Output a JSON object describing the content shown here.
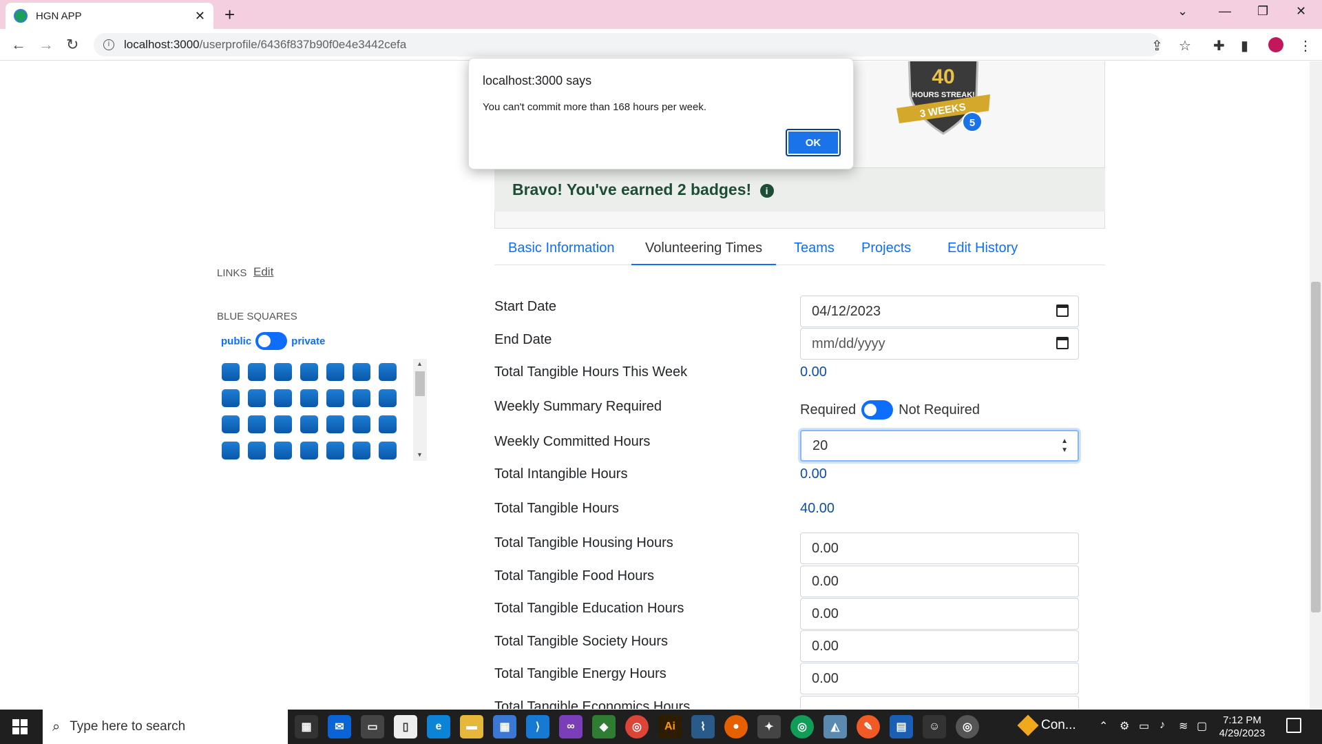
{
  "browser": {
    "tab_title": "HGN APP",
    "url_host": "localhost:3000",
    "url_path": "/userprofile/6436f837b90f0e4e3442cefa"
  },
  "badges": {
    "badge_text_top": "40",
    "badge_text_mid": "HOURS STREAK!",
    "badge_ribbon": "3 WEEKS",
    "badge_count": "5",
    "bravo_text": "Bravo! You've earned 2 badges!"
  },
  "tabs": [
    {
      "label": "Basic Information"
    },
    {
      "label": "Volunteering Times"
    },
    {
      "label": "Teams"
    },
    {
      "label": "Projects"
    },
    {
      "label": "Edit History"
    }
  ],
  "sidebar": {
    "links_label": "LINKS",
    "links_edit": "Edit",
    "blue_squares_label": "BLUE SQUARES",
    "public_label": "public",
    "private_label": "private"
  },
  "form": {
    "start_date_label": "Start Date",
    "start_date_value": "04/12/2023",
    "end_date_label": "End Date",
    "end_date_placeholder": "mm/dd/yyyy",
    "tangible_week_label": "Total Tangible Hours This Week",
    "tangible_week_value": "0.00",
    "weekly_summary_label": "Weekly Summary Required",
    "required_label": "Required",
    "not_required_label": "Not Required",
    "committed_label": "Weekly Committed Hours",
    "committed_value": "20",
    "intangible_label": "Total Intangible Hours",
    "intangible_value": "0.00",
    "tangible_total_label": "Total Tangible Hours",
    "tangible_total_value": "40.00",
    "housing_label": "Total Tangible Housing Hours",
    "housing_value": "0.00",
    "food_label": "Total Tangible Food Hours",
    "food_value": "0.00",
    "education_label": "Total Tangible Education Hours",
    "education_value": "0.00",
    "society_label": "Total Tangible Society Hours",
    "society_value": "0.00",
    "energy_label": "Total Tangible Energy Hours",
    "energy_value": "0.00",
    "economics_label": "Total Tangible Economics Hours"
  },
  "alert": {
    "title": "localhost:3000 says",
    "message": "You can't commit more than 168 hours per week.",
    "ok_label": "OK"
  },
  "taskbar": {
    "search_placeholder": "Type here to search",
    "connection_label": "Con...",
    "time": "7:12 PM",
    "date": "4/29/2023"
  },
  "colors": {
    "tabbar_bg": "#f4cfe0",
    "link_blue": "#0d6efd",
    "bravo_green": "#1d4d35",
    "value_blue": "#0d4ea6",
    "ok_button": "#1a73e8"
  }
}
